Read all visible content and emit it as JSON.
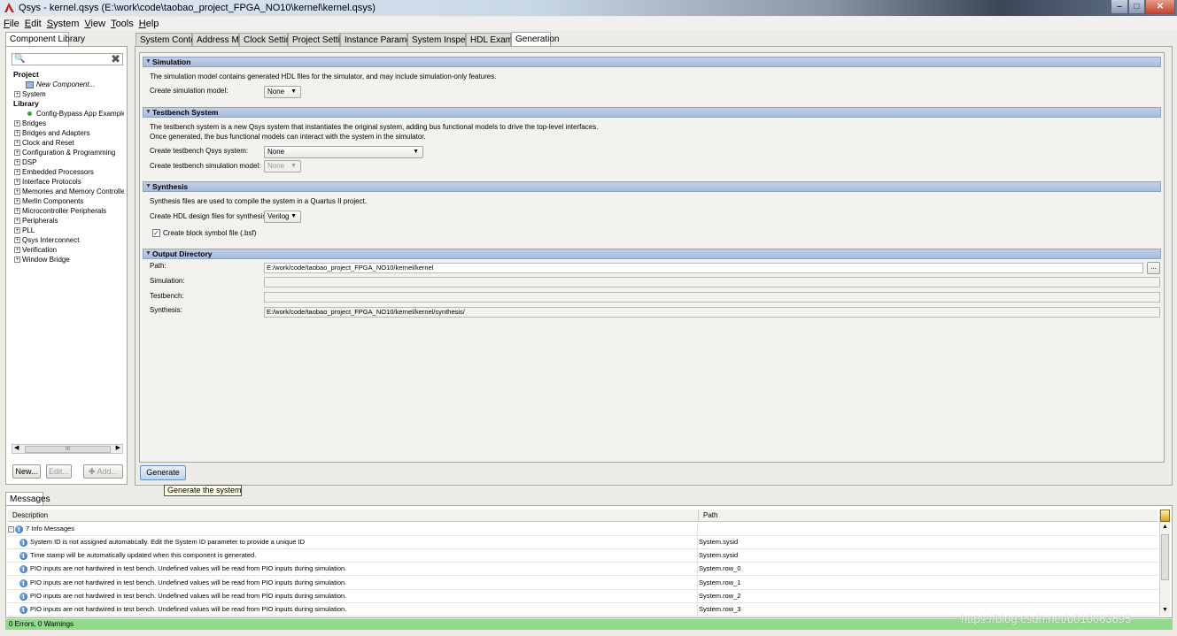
{
  "window": {
    "title": "Qsys - kernel.qsys (E:\\work\\code\\taobao_project_FPGA_NO10\\kernel\\kernel.qsys)",
    "min_glyph": "–",
    "max_glyph": "□",
    "close_glyph": "✕"
  },
  "menu": [
    {
      "label": "File",
      "key": "F",
      "rest": "ile"
    },
    {
      "label": "Edit",
      "key": "E",
      "rest": "dit"
    },
    {
      "label": "System",
      "key": "S",
      "rest": "ystem"
    },
    {
      "label": "View",
      "key": "V",
      "rest": "iew"
    },
    {
      "label": "Tools",
      "key": "T",
      "rest": "ools"
    },
    {
      "label": "Help",
      "key": "H",
      "rest": "elp"
    }
  ],
  "library": {
    "tab_label": "Component Library",
    "search_value": "",
    "tree": {
      "project_heading": "Project",
      "new_component": "New Component...",
      "system": "System",
      "library_heading": "Library",
      "config_bypass": "Config-Bypass App Example",
      "items": [
        "Bridges",
        "Bridges and Adapters",
        "Clock and Reset",
        "Configuration & Programming",
        "DSP",
        "Embedded Processors",
        "Interface Protocols",
        "Memories and Memory Controllers",
        "Merlin Components",
        "Microcontroller Peripherals",
        "Peripherals",
        "PLL",
        "Qsys Interconnect",
        "Verification",
        "Window Bridge"
      ]
    },
    "scroll_grip": "III",
    "buttons": {
      "new": "New...",
      "edit": "Edit...",
      "add": "Add..."
    }
  },
  "tabs": [
    "System Contents",
    "Address Map",
    "Clock Settings",
    "Project Settings",
    "Instance Parameters",
    "System Inspector",
    "HDL Example",
    "Generation"
  ],
  "active_tab": "Generation",
  "generation": {
    "simulation": {
      "heading": "Simulation",
      "description": "The simulation model contains generated HDL files for the simulator, and may include simulation-only features.",
      "model_label": "Create simulation model:",
      "model_value": "None"
    },
    "testbench": {
      "heading": "Testbench System",
      "description_1": "The testbench system is a new Qsys system that instantiates the original system, adding bus functional models to drive the top-level interfaces.",
      "description_2": "Once generated, the bus functional models can interact with the system in the simulator.",
      "qsys_label": "Create testbench Qsys system:",
      "qsys_value": "None",
      "sim_model_label": "Create testbench simulation model:",
      "sim_model_value": "None"
    },
    "synthesis": {
      "heading": "Synthesis",
      "description": "Synthesis files are used to compile the system in a Quartus II project.",
      "hdl_label": "Create HDL design files for synthesis:",
      "hdl_value": "Verilog",
      "bsf_label": "Create block symbol file (.bsf)",
      "bsf_checked": true
    },
    "output": {
      "heading": "Output Directory",
      "path_label": "Path:",
      "path_value": "E:/work/code/taobao_project_FPGA_NO10/kernel/kernel",
      "browse_label": "...",
      "simulation_label": "Simulation:",
      "simulation_value": "",
      "testbench_label": "Testbench:",
      "testbench_value": "",
      "synthesis_label": "Synthesis:",
      "synthesis_value": "E:/work/code/taobao_project_FPGA_NO10/kernel/kernel/synthesis/"
    },
    "generate_button": "Generate",
    "tooltip": "Generate the system"
  },
  "messages": {
    "tab_label": "Messages",
    "columns": {
      "description": "Description",
      "path": "Path"
    },
    "group_label": "7 Info Messages",
    "rows": [
      {
        "description": "System ID is not assigned automatically. Edit the System ID parameter to provide a unique ID",
        "path": "System.sysid"
      },
      {
        "description": "Time stamp will be automatically updated when this component is generated.",
        "path": "System.sysid"
      },
      {
        "description": "PIO inputs are not hardwired in test bench. Undefined values will be read from PIO inputs during simulation.",
        "path": "System.row_0"
      },
      {
        "description": "PIO inputs are not hardwired in test bench. Undefined values will be read from PIO inputs during simulation.",
        "path": "System.row_1"
      },
      {
        "description": "PIO inputs are not hardwired in test bench. Undefined values will be read from PIO inputs during simulation.",
        "path": "System.row_2"
      },
      {
        "description": "PIO inputs are not hardwired in test bench. Undefined values will be read from PIO inputs during simulation.",
        "path": "System.row_3"
      }
    ]
  },
  "status": "0 Errors, 0 Warnings",
  "watermark": "https://blog.csdn.net/u010063895"
}
